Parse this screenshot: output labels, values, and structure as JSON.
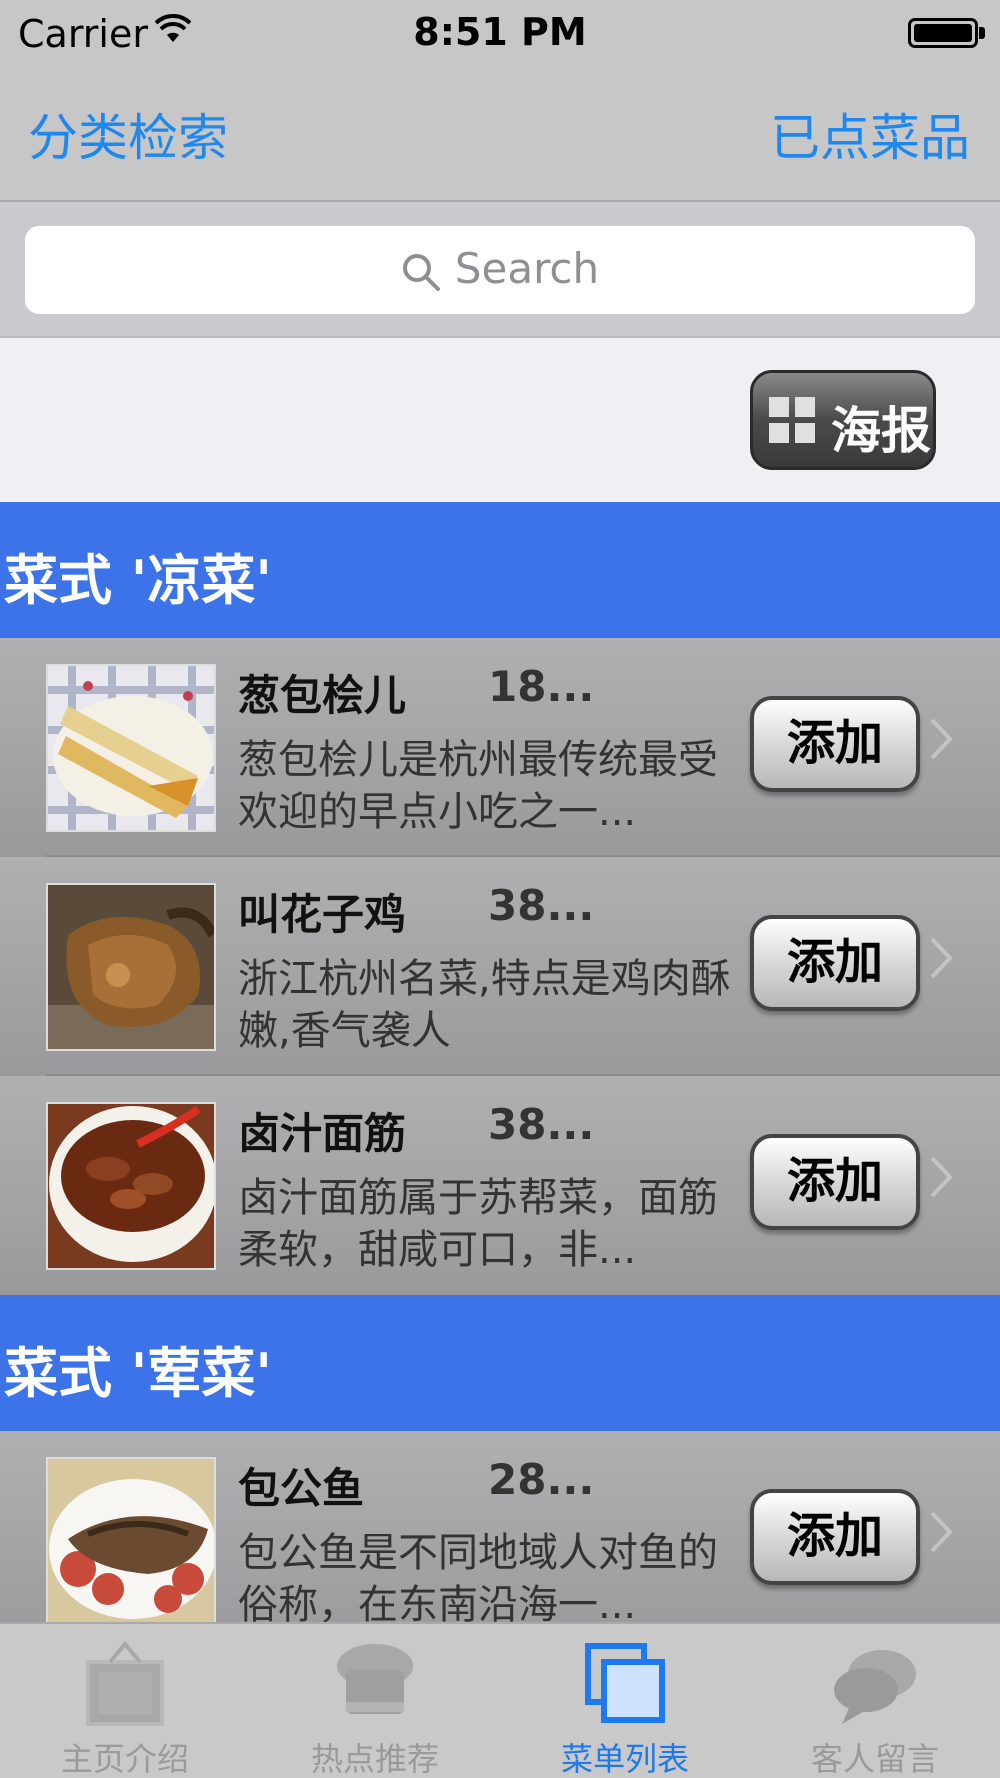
{
  "status": {
    "carrier": "Carrier",
    "time": "8:51 PM"
  },
  "nav": {
    "left": "分类检索",
    "right": "已点菜品"
  },
  "search": {
    "placeholder": "Search"
  },
  "toolbar": {
    "poster_label": "海报"
  },
  "sections": [
    {
      "title": "菜式 '凉菜'",
      "items": [
        {
          "name": "葱包桧儿",
          "price": "18...",
          "desc": "葱包桧儿是杭州最传统最受欢迎的早点小吃之一...",
          "add": "添加"
        },
        {
          "name": "叫花子鸡",
          "price": "38...",
          "desc": "浙江杭州名菜,特点是鸡肉酥嫩,香气袭人",
          "add": "添加"
        },
        {
          "name": "卤汁面筋",
          "price": "38...",
          "desc": "卤汁面筋属于苏帮菜，面筋柔软，甜咸可口，非...",
          "add": "添加"
        }
      ]
    },
    {
      "title": "菜式 '荤菜'",
      "items": [
        {
          "name": "包公鱼",
          "price": "28...",
          "desc": "包公鱼是不同地域人对鱼的俗称，在东南沿海一...",
          "add": "添加"
        }
      ]
    }
  ],
  "tabs": [
    {
      "label": "主页介绍",
      "icon": "home-bag-icon",
      "active": false
    },
    {
      "label": "热点推荐",
      "icon": "chef-hat-icon",
      "active": false
    },
    {
      "label": "菜单列表",
      "icon": "menu-list-icon",
      "active": true
    },
    {
      "label": "客人留言",
      "icon": "chat-bubbles-icon",
      "active": false
    }
  ],
  "colors": {
    "accent": "#1e88f0",
    "section_header": "#3d73e8",
    "tab_active": "#1e78ee"
  }
}
